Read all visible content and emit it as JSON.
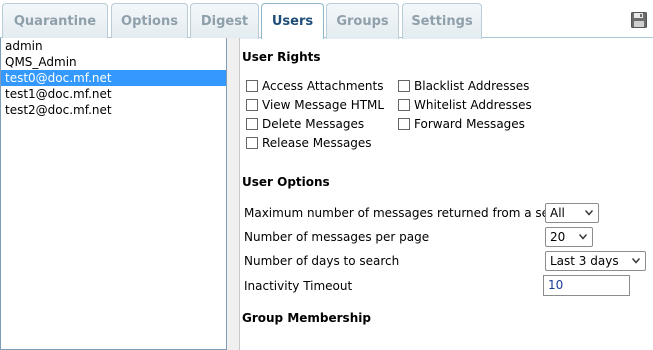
{
  "tabs": [
    {
      "label": "Quarantine"
    },
    {
      "label": "Options"
    },
    {
      "label": "Digest"
    },
    {
      "label": "Users",
      "active": true
    },
    {
      "label": "Groups"
    },
    {
      "label": "Settings"
    }
  ],
  "toolbar": {
    "save_icon": "floppy-disk-icon"
  },
  "users": [
    "admin",
    "QMS_Admin",
    "test0@doc.mf.net",
    "test1@doc.mf.net",
    "test2@doc.mf.net"
  ],
  "selected_user": "test0@doc.mf.net",
  "user_rights": {
    "title": "User Rights",
    "left": [
      {
        "label": "Access Attachments",
        "checked": false
      },
      {
        "label": "View Message HTML",
        "checked": false
      },
      {
        "label": "Delete Messages",
        "checked": false
      },
      {
        "label": "Release Messages",
        "checked": false
      }
    ],
    "right": [
      {
        "label": "Blacklist Addresses",
        "checked": false
      },
      {
        "label": "Whitelist Addresses",
        "checked": false
      },
      {
        "label": "Forward Messages",
        "checked": false
      }
    ]
  },
  "user_options": {
    "title": "User Options",
    "max_messages_label": "Maximum number of messages returned from a search",
    "max_messages_value": "All",
    "per_page_label": "Number of messages per page",
    "per_page_value": "20",
    "days_label": "Number of days to search",
    "days_value": "Last 3 days",
    "timeout_label": "Inactivity Timeout",
    "timeout_value": "10"
  },
  "group_membership": {
    "title": "Group Membership"
  },
  "colors": {
    "selection": "#3399ff",
    "active_tab_text": "#1f4e79",
    "inactive_tab_text": "#8fa0ab"
  }
}
